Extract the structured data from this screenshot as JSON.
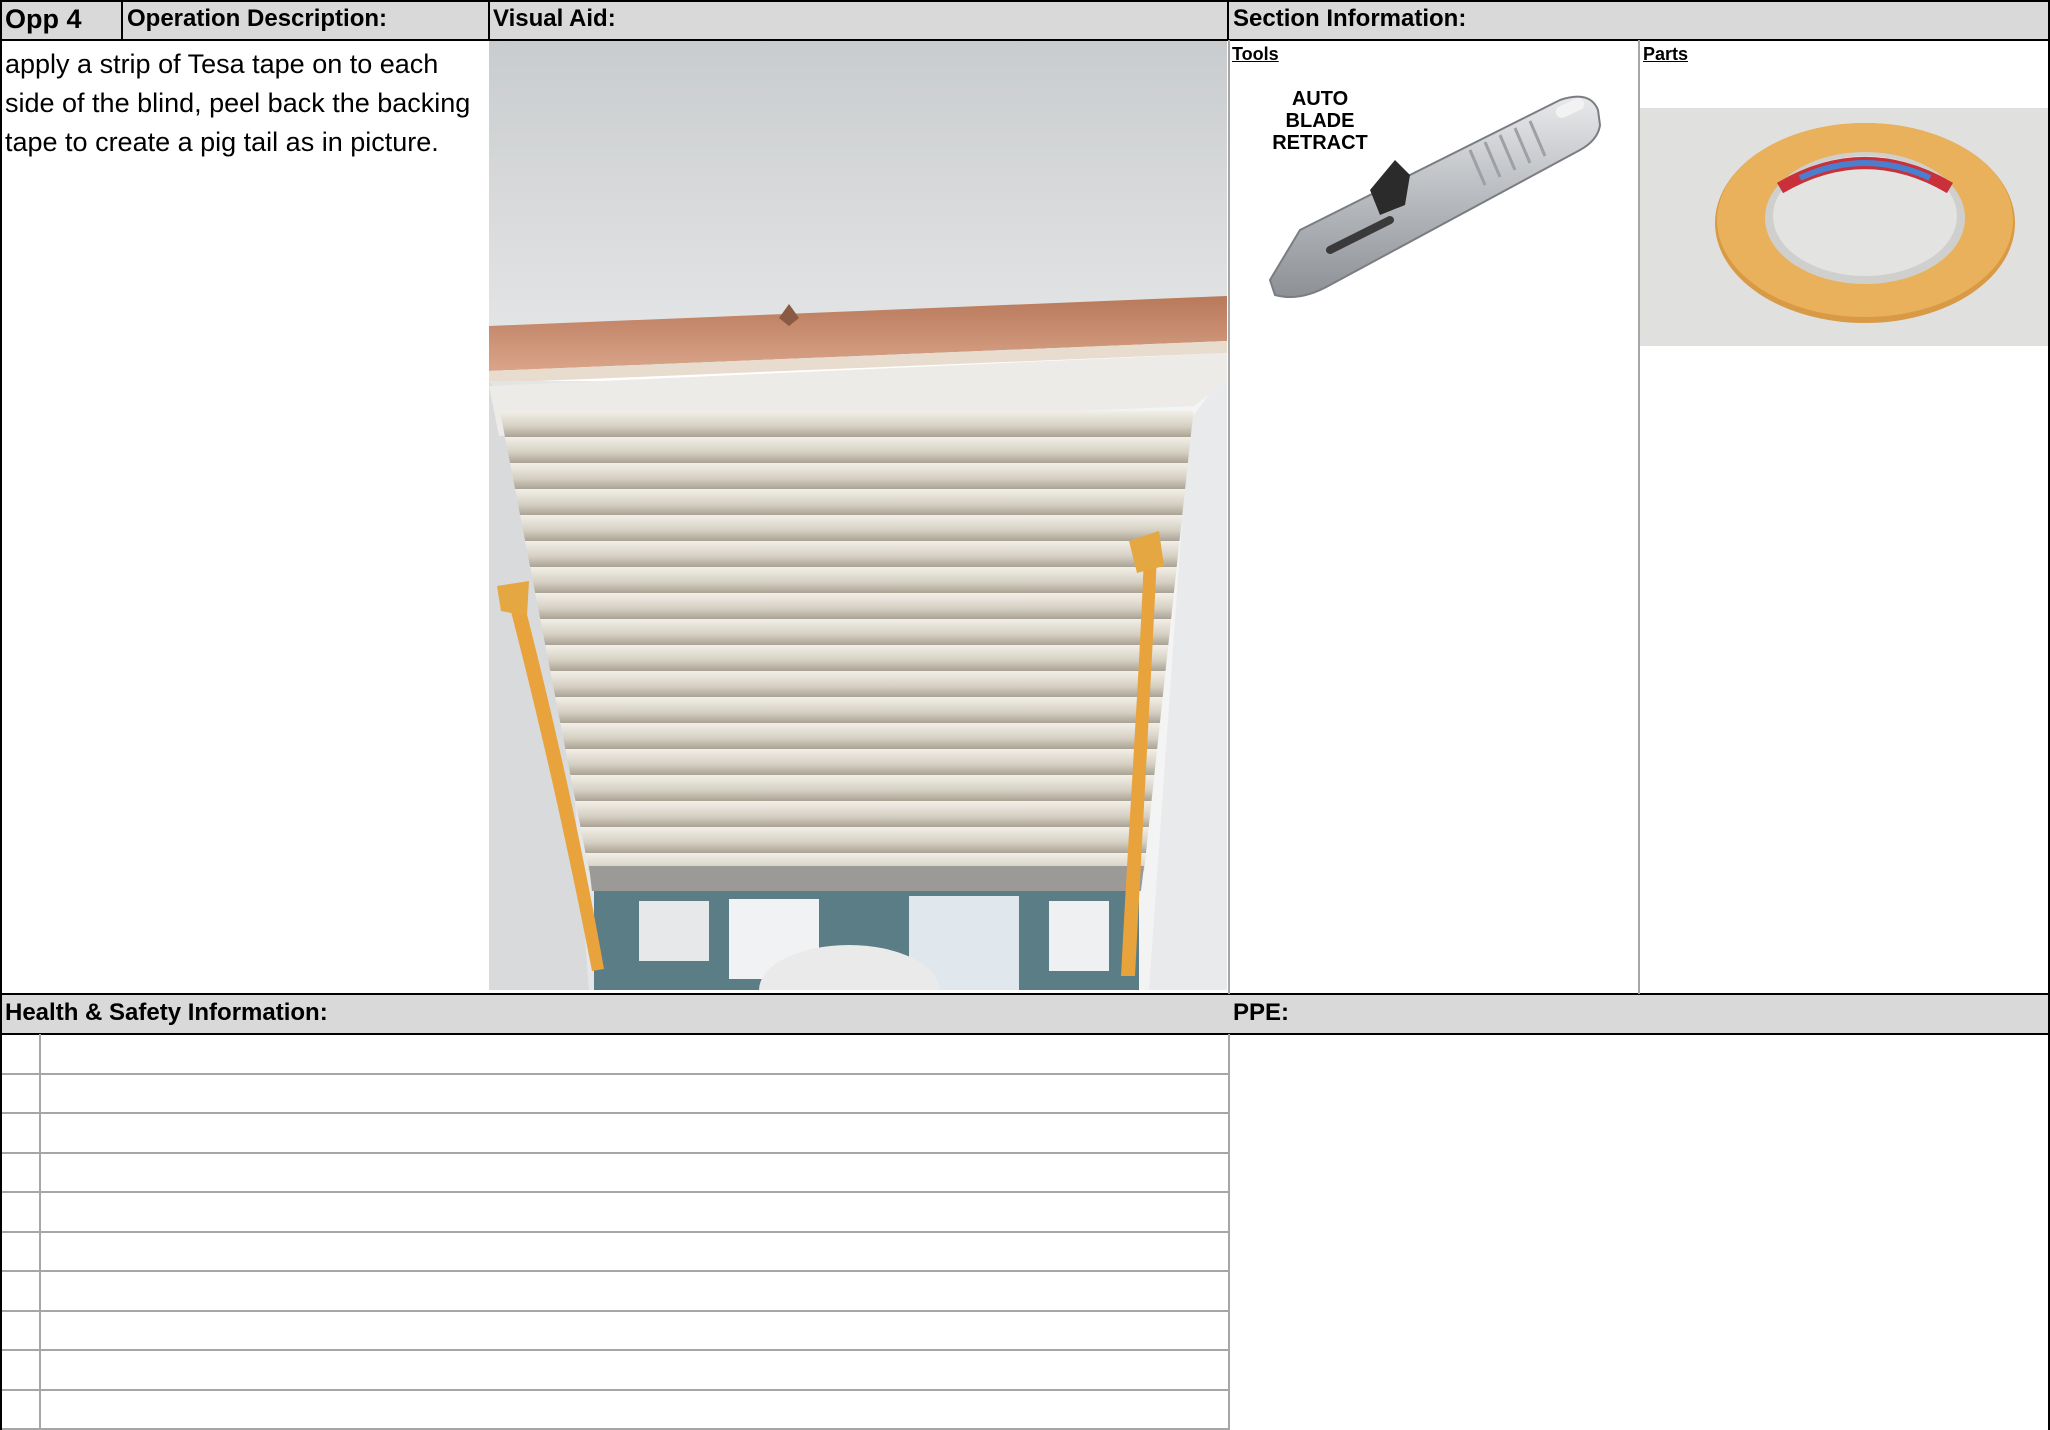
{
  "header": {
    "opp_label": "Opp 4",
    "operation_description_label": "Operation Description:",
    "visual_aid_label": "Visual Aid:",
    "section_information_label": "Section Information:"
  },
  "operation": {
    "description": "apply a strip of Tesa tape on to each side of the blind, peel back the backing tape to create a pig tail as in picture."
  },
  "section_information": {
    "tools_label": "Tools ",
    "parts_label": "Parts",
    "knife_caption_lines": [
      "AUTO",
      "BLADE",
      "RETRACT"
    ]
  },
  "footer": {
    "health_safety_label": "Health & Safety Information:",
    "ppe_label": "PPE:",
    "health_safety_rows": [
      "",
      "",
      "",
      "",
      "",
      "",
      "",
      "",
      "",
      ""
    ]
  },
  "colors": {
    "header_bg": "#d9d9d9",
    "tape_orange": "#e8a33c",
    "blind_beige": "#d8d2c4",
    "wood_trim": "#c98f6a"
  },
  "icons": {
    "tool_image": "utility-knife-icon",
    "part_image": "tesa-tape-roll-icon",
    "visual_aid_image": "window-blind-photo"
  }
}
